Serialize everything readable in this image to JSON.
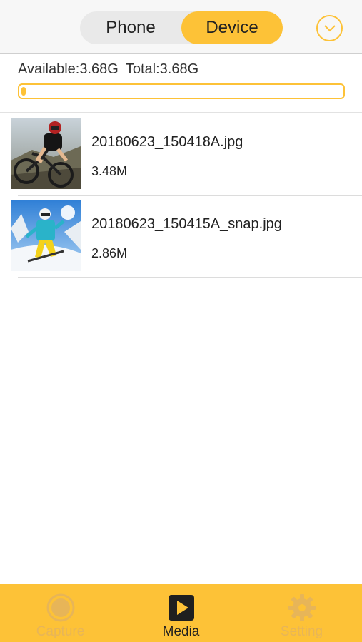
{
  "header": {
    "segments": [
      {
        "label": "Phone",
        "active": false
      },
      {
        "label": "Device",
        "active": true
      }
    ],
    "dropdown_icon": "chevron-down-icon",
    "accent_color": "#fdc237"
  },
  "storage": {
    "available_label": "Available:3.68G",
    "total_label": "Total:3.68G",
    "used_fraction": 0.01
  },
  "files": [
    {
      "name": "20180623_150418A.jpg",
      "size": "3.48M",
      "thumb": "mountain-bike-photo"
    },
    {
      "name": "20180623_150415A_snap.jpg",
      "size": "2.86M",
      "thumb": "skier-photo"
    }
  ],
  "tabbar": {
    "tabs": [
      {
        "label": "Capture",
        "icon": "capture-icon",
        "active": false
      },
      {
        "label": "Media",
        "icon": "media-play-icon",
        "active": true
      },
      {
        "label": "Setting",
        "icon": "gear-icon",
        "active": false
      }
    ]
  }
}
